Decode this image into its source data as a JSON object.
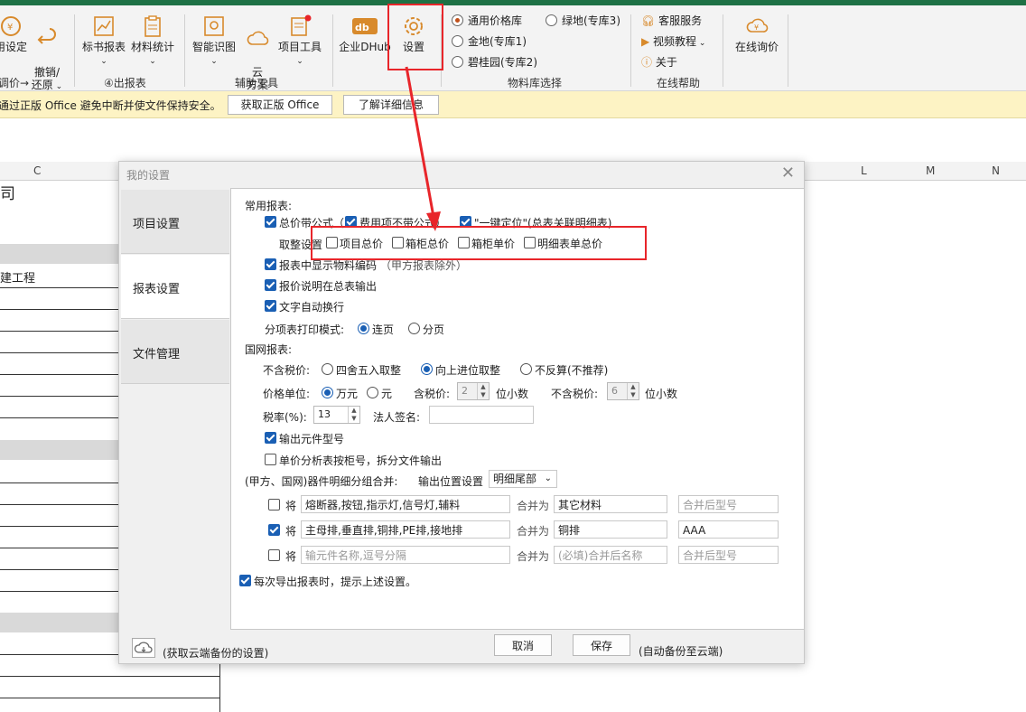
{
  "ribbon": {
    "buttons": [
      {
        "label": "用设定"
      },
      {
        "label": "撤销/\n还原"
      },
      {
        "label": "标书报表"
      },
      {
        "label": "材料统计"
      },
      {
        "label": "智能识图"
      },
      {
        "label": "云\n方案"
      },
      {
        "label": "项目工具"
      },
      {
        "label": "企业DHub"
      },
      {
        "label": "设置"
      },
      {
        "label": "在线询价"
      }
    ],
    "group_labels": {
      "g1": "调价→",
      "g2": "④出报表",
      "g3": "辅助工具",
      "g4": "物料库选择",
      "g5": "在线帮助"
    },
    "material_lib": {
      "opt1": "通用价格库",
      "opt2": "金地(专库1)",
      "opt3": "碧桂园(专库2)",
      "opt4": "绿地(专库3)"
    },
    "help": {
      "service": "客服服务",
      "video": "视频教程",
      "about": "关于"
    }
  },
  "notice": {
    "text": "通过正版 Office 避免中断并使文件保持安全。",
    "btn_get": "获取正版 Office",
    "btn_more": "了解详细信息"
  },
  "sheet": {
    "col_c": "C",
    "col_l": "L",
    "col_m": "M",
    "col_n": "N",
    "cell_title": "司",
    "cell_project": "建工程"
  },
  "dialog": {
    "title": "我的设置",
    "nav": {
      "project": "项目设置",
      "report": "报表设置",
      "file": "文件管理"
    },
    "common_reports": "常用报表:",
    "total_formula": "总价带公式（",
    "fee_no_formula": "费用项不带公式）",
    "one_key": "\"一键定位\"(总表关联明细表)",
    "rounding_label": "取整设置",
    "round_project_total": "项目总价",
    "round_cabinet_total": "箱柜总价",
    "round_cabinet_unit": "箱柜单价",
    "round_detail_total": "明细表单总价",
    "show_material_code": "报表中显示物料编码",
    "show_material_code_note": "（甲方报表除外）",
    "quote_note": "报价说明在总表输出",
    "auto_wrap": "文字自动换行",
    "print_mode_label": "分项表打印模式:",
    "print_continuous": "连页",
    "print_paged": "分页",
    "state_grid": "国网报表:",
    "excl_tax_label": "不含税价:",
    "round_half": "四舍五入取整",
    "round_up": "向上进位取整",
    "no_reverse": "不反算(不推荐)",
    "price_unit_label": "价格单位:",
    "unit_wan": "万元",
    "unit_yuan": "元",
    "incl_tax_label": "含税价:",
    "incl_tax_digits": "2",
    "decimals_1": "位小数",
    "excl_tax_price_label": "不含税价:",
    "excl_tax_digits": "6",
    "decimals_2": "位小数",
    "tax_rate_label": "税率(%):",
    "tax_rate": "13",
    "legal_sign_label": "法人签名:",
    "legal_sign_value": "",
    "output_model": "输出元件型号",
    "unit_analysis": "单价分析表按柜号，拆分文件输出",
    "merge_label": "(甲方、国网)器件明细分组合并:",
    "output_pos_label": "输出位置设置",
    "output_pos_value": "明细尾部",
    "merge_rows": [
      {
        "prefix": "将",
        "items": "熔断器,按钮,指示灯,信号灯,辅料",
        "merge_to": "合并为",
        "name": "其它材料",
        "model": "合并后型号"
      },
      {
        "prefix": "将",
        "items": "主母排,垂直排,铜排,PE排,接地排",
        "merge_to": "合并为",
        "name": "铜排",
        "model": "AAA"
      },
      {
        "prefix": "将",
        "items": "输元件名称,逗号分隔",
        "merge_to": "合并为",
        "name": "(必填)合并后名称",
        "model": "合并后型号"
      }
    ],
    "prompt_each_export": "每次导出报表时，提示上述设置。",
    "cloud_hint": "(获取云端备份的设置)",
    "cancel": "取消",
    "save": "保存",
    "auto_backup": "(自动备份至云端)"
  }
}
